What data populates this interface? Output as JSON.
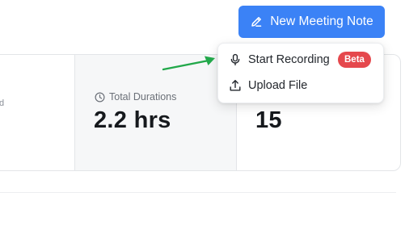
{
  "header": {
    "new_note_button": {
      "label": "New Meeting Note",
      "icon": "pencil-icon"
    }
  },
  "colors": {
    "primary": "#3b82f6",
    "badge": "#e5484d",
    "arrow": "#22a84a"
  },
  "stats": {
    "partial_label": "d",
    "total_durations": {
      "label": "Total Durations",
      "icon": "clock-icon",
      "value": "2.2 hrs"
    },
    "third": {
      "value": "15"
    }
  },
  "menu": {
    "items": [
      {
        "label": "Start Recording",
        "icon": "microphone-icon",
        "badge": "Beta"
      },
      {
        "label": "Upload File",
        "icon": "upload-icon"
      }
    ]
  }
}
